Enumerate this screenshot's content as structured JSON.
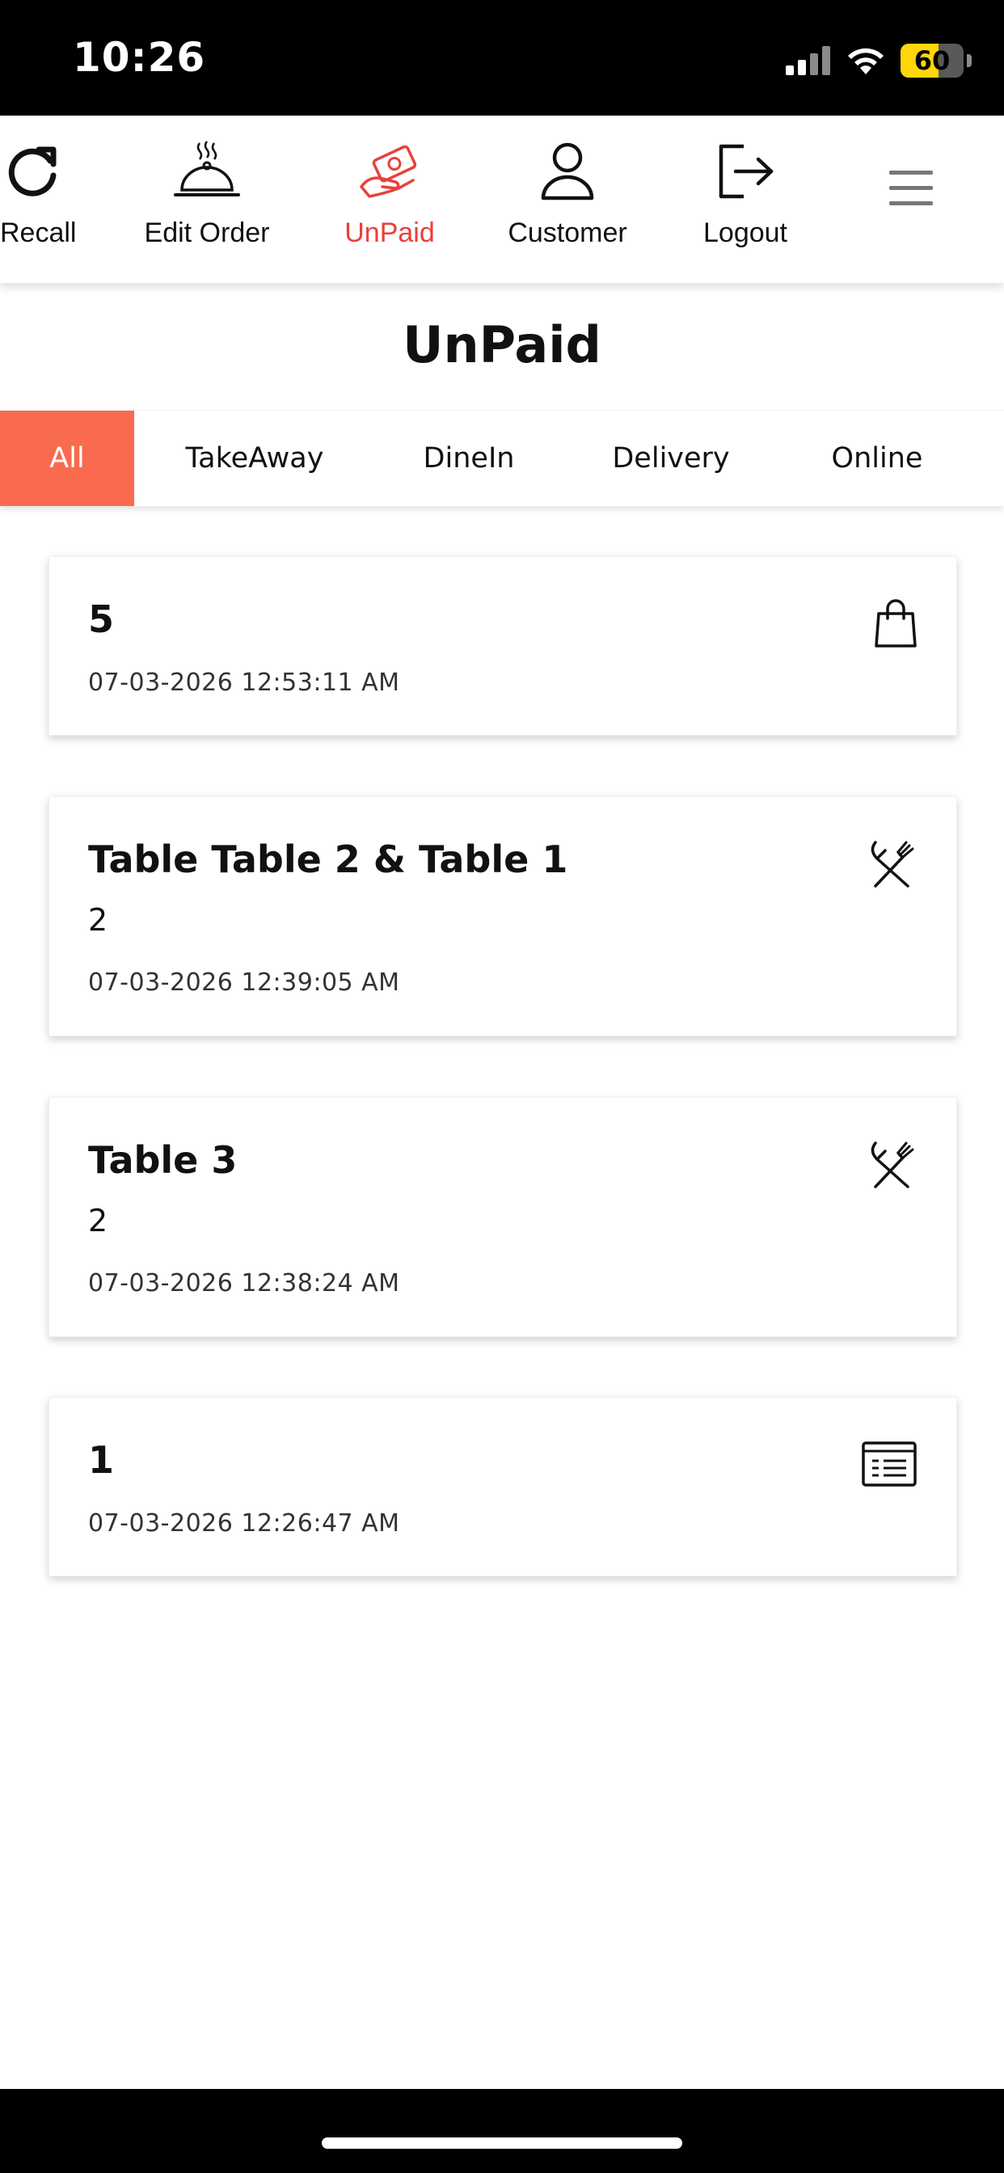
{
  "status_bar": {
    "time": "10:26",
    "battery_text": "60",
    "battery_level": 0.6,
    "battery_color": "#ffd60a"
  },
  "nav": {
    "items": [
      {
        "label": "Recall",
        "icon": "refresh-icon"
      },
      {
        "label": "Edit Order",
        "icon": "serving-cloche-icon"
      },
      {
        "label": "UnPaid",
        "icon": "cash-hand-icon",
        "active": true
      },
      {
        "label": "Customer",
        "icon": "user-icon"
      },
      {
        "label": "Logout",
        "icon": "logout-icon"
      }
    ],
    "menu_icon": "hamburger-menu-icon",
    "active_color": "#e8413a"
  },
  "page": {
    "title": "UnPaid"
  },
  "tabs": {
    "items": [
      {
        "label": "All",
        "active": true
      },
      {
        "label": "TakeAway"
      },
      {
        "label": "DineIn"
      },
      {
        "label": "Delivery"
      },
      {
        "label": "Online"
      }
    ],
    "active_color": "#f96a4e"
  },
  "orders": [
    {
      "title": "5",
      "subtitle": "",
      "time": "07-03-2026 12:53:11 AM",
      "icon": "shopping-bag-icon"
    },
    {
      "title": "Table Table 2 & Table 1",
      "subtitle": "2",
      "time": "07-03-2026 12:39:05 AM",
      "icon": "fork-spoon-icon"
    },
    {
      "title": "Table 3",
      "subtitle": "2",
      "time": "07-03-2026 12:38:24 AM",
      "icon": "fork-spoon-icon"
    },
    {
      "title": "1",
      "subtitle": "",
      "time": "07-03-2026 12:26:47 AM",
      "icon": "receipt-list-icon"
    }
  ]
}
